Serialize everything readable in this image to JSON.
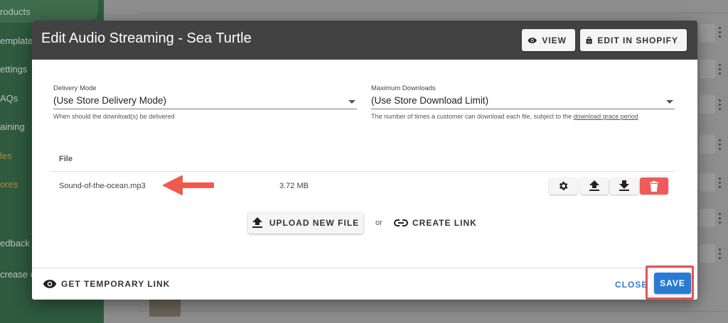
{
  "background": {
    "nav": [
      {
        "label": "roducts"
      },
      {
        "label": "emplate"
      },
      {
        "label": "ettings"
      },
      {
        "label": "AQs"
      },
      {
        "label": "aining"
      },
      {
        "label": "les"
      },
      {
        "label": "ores"
      },
      {
        "label": "edback"
      },
      {
        "label": "crease c"
      }
    ]
  },
  "modal": {
    "title": "Edit Audio Streaming - Sea Turtle",
    "header_buttons": {
      "view_label": "VIEW",
      "view_icon": "eye-icon",
      "shopify_label": "EDIT IN SHOPIFY",
      "shopify_icon": "shopping-bag-icon"
    },
    "delivery_mode": {
      "label": "Delivery Mode",
      "value": "(Use Store Delivery Mode)",
      "hint": "When should the download(s) be delivered"
    },
    "max_downloads": {
      "label": "Maximum Downloads",
      "value": "(Use Store Download Limit)",
      "hint": "The number of times a customer can download each file, subject to the ",
      "hint_link": "download grace period"
    },
    "files": {
      "header": "File",
      "rows": [
        {
          "name": "Sound-of-the-ocean.mp3",
          "size": "3.72 MB"
        }
      ],
      "row_actions": [
        "gear-icon",
        "upload-icon",
        "download-icon",
        "trash-icon"
      ]
    },
    "upload_label": "UPLOAD NEW FILE",
    "or_text": "or",
    "create_link_label": "CREATE LINK",
    "temp_link_label": "GET TEMPORARY LINK",
    "close_label": "CLOSE",
    "save_label": "SAVE"
  },
  "colors": {
    "header_bg": "#424242",
    "primary": "#2a7ad4",
    "danger": "#f05a5a",
    "annotation": "#ef4f4f",
    "sidebar_bg": "#2f5a3e"
  }
}
